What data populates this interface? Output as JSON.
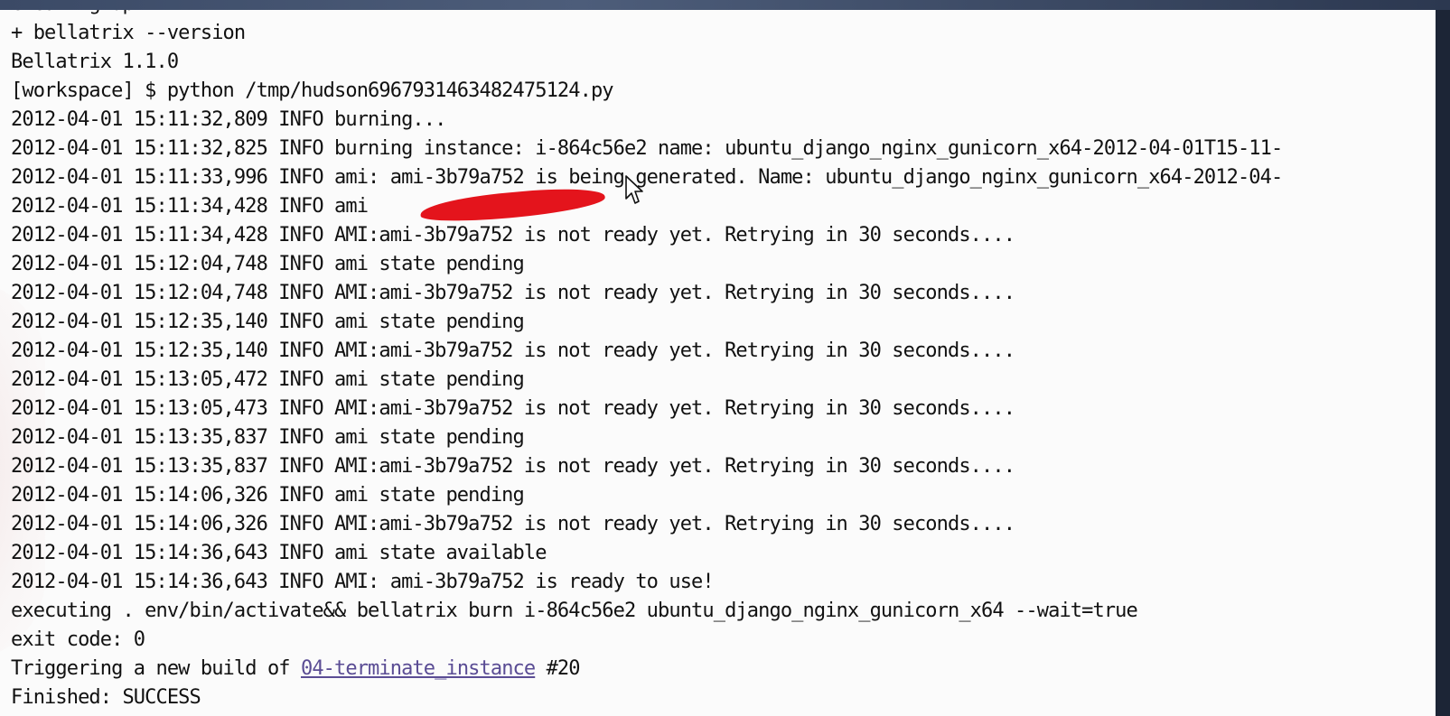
{
  "console": {
    "lines": [
      "Cleaning up...",
      "+ bellatrix --version",
      "Bellatrix 1.1.0",
      "[workspace] $ python /tmp/hudson6967931463482475124.py",
      "2012-04-01 15:11:32,809 INFO burning...",
      "2012-04-01 15:11:32,825 INFO burning instance: i-864c56e2 name: ubuntu_django_nginx_gunicorn_x64-2012-04-01T15-11-",
      "2012-04-01 15:11:33,996 INFO ami: ami-3b79a752 is being generated. Name: ubuntu_django_nginx_gunicorn_x64-2012-04-",
      "2012-04-01 15:11:34,428 INFO ami",
      "2012-04-01 15:11:34,428 INFO AMI:ami-3b79a752 is not ready yet. Retrying in 30 seconds....",
      "2012-04-01 15:12:04,748 INFO ami state pending",
      "2012-04-01 15:12:04,748 INFO AMI:ami-3b79a752 is not ready yet. Retrying in 30 seconds....",
      "2012-04-01 15:12:35,140 INFO ami state pending",
      "2012-04-01 15:12:35,140 INFO AMI:ami-3b79a752 is not ready yet. Retrying in 30 seconds....",
      "2012-04-01 15:13:05,472 INFO ami state pending",
      "2012-04-01 15:13:05,473 INFO AMI:ami-3b79a752 is not ready yet. Retrying in 30 seconds....",
      "2012-04-01 15:13:35,837 INFO ami state pending",
      "2012-04-01 15:13:35,837 INFO AMI:ami-3b79a752 is not ready yet. Retrying in 30 seconds....",
      "2012-04-01 15:14:06,326 INFO ami state pending",
      "2012-04-01 15:14:06,326 INFO AMI:ami-3b79a752 is not ready yet. Retrying in 30 seconds....",
      "2012-04-01 15:14:36,643 INFO ami state available",
      "2012-04-01 15:14:36,643 INFO AMI: ami-3b79a752 is ready to use!",
      "executing . env/bin/activate&& bellatrix burn i-864c56e2 ubuntu_django_nginx_gunicorn_x64 --wait=true",
      "exit code: 0"
    ],
    "trigger": {
      "prefix": "Triggering a new build of ",
      "link": "04-terminate_instance",
      "suffix": " #20"
    },
    "finished": "Finished: SUCCESS"
  },
  "colors": {
    "text": "#111111",
    "link": "#5a4c94",
    "redaction": "#e4141c",
    "background": "#fbfbfb"
  },
  "icons": {
    "cursor": "mouse-pointer-icon"
  }
}
